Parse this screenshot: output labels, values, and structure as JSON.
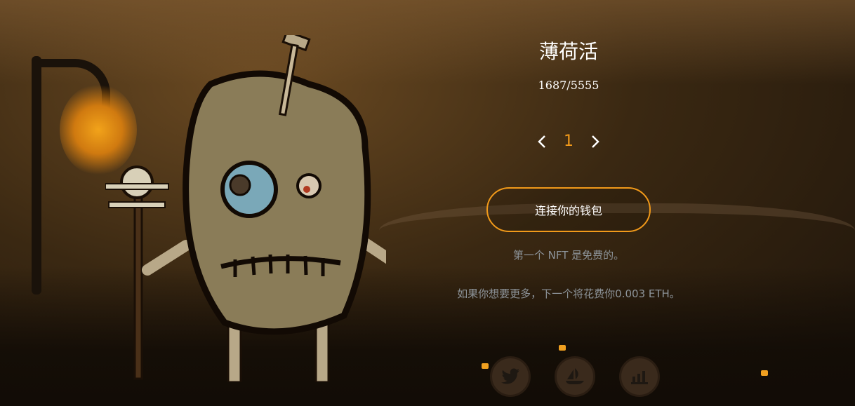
{
  "collection": {
    "title": "薄荷活",
    "supply": "1687/5555"
  },
  "mint": {
    "quantity": "1",
    "connect_label": "连接你的钱包",
    "free_note": "第一个 NFT 是免费的。",
    "price_note": "如果你想要更多，下一个将花费你0.003 ETH。"
  },
  "colors": {
    "accent": "#f29a1a",
    "muted_text": "#8d949a"
  },
  "socials": [
    {
      "icon": "twitter-icon"
    },
    {
      "icon": "opensea-icon"
    },
    {
      "icon": "looksrare-icon"
    }
  ]
}
